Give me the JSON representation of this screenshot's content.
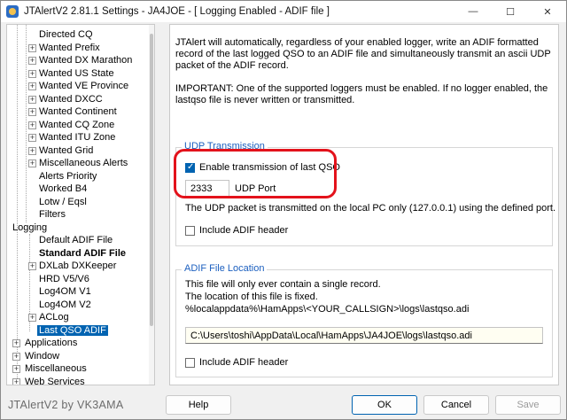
{
  "window": {
    "title": "JTAlertV2  2.81.1 Settings  -  JA4JOE  -  [ Logging Enabled - ADIF file ]",
    "minimize": "—",
    "maximize": "☐",
    "close": "✕"
  },
  "tree": {
    "items": [
      {
        "label": "Directed CQ"
      },
      {
        "label": "Wanted Prefix"
      },
      {
        "label": "Wanted DX Marathon"
      },
      {
        "label": "Wanted US State"
      },
      {
        "label": "Wanted VE Province"
      },
      {
        "label": "Wanted DXCC"
      },
      {
        "label": "Wanted Continent"
      },
      {
        "label": "Wanted CQ Zone"
      },
      {
        "label": "Wanted ITU Zone"
      },
      {
        "label": "Wanted Grid"
      },
      {
        "label": "Miscellaneous Alerts"
      },
      {
        "label": "Alerts Priority"
      },
      {
        "label": "Worked B4"
      },
      {
        "label": "Lotw / Eqsl"
      },
      {
        "label": "Filters"
      },
      {
        "label": "Logging"
      },
      {
        "label": "Default ADIF File"
      },
      {
        "label": "Standard ADIF File"
      },
      {
        "label": "DXLab DXKeeper"
      },
      {
        "label": "HRD V5/V6"
      },
      {
        "label": "Log4OM V1"
      },
      {
        "label": "Log4OM V2"
      },
      {
        "label": "ACLog"
      },
      {
        "label": "Last QSO ADIF"
      },
      {
        "label": "Applications"
      },
      {
        "label": "Window"
      },
      {
        "label": "Miscellaneous"
      },
      {
        "label": "Web Services"
      }
    ]
  },
  "panel": {
    "intro": "JTAlert will automatically, regardless of your enabled logger, write an ADIF formatted record of the last logged QSO to an ADIF file and simultaneously transmit an ascii UDP packet of the ADIF record.",
    "important": "IMPORTANT: One of the supported loggers must be enabled. If no logger enabled, the lastqso file is never written or transmitted.",
    "udp": {
      "title": "UDP Transmission",
      "enable_label": "Enable transmission of last QSO",
      "enable_checked": true,
      "port_value": "2333",
      "port_label": "UDP Port",
      "info": "The UDP packet is transmitted on the local PC only (127.0.0.1) using the defined port.",
      "header_label": "Include ADIF header",
      "header_checked": false
    },
    "adif": {
      "title": "ADIF File Location",
      "line1": "This file will only ever contain a single record.",
      "line2": "The location of this file is fixed.",
      "line3": "%localappdata%\\HamApps\\<YOUR_CALLSIGN>\\logs\\lastqso.adi",
      "path_value": "C:\\Users\\toshi\\AppData\\Local\\HamApps\\JA4JOE\\logs\\lastqso.adi",
      "header_label": "Include ADIF header",
      "header_checked": false
    }
  },
  "footer": {
    "credit": "JTAlertV2 by VK3AMA",
    "help": "Help",
    "ok": "OK",
    "cancel": "Cancel",
    "save": "Save"
  },
  "colors": {
    "accent": "#0063b1",
    "group_title": "#1b5fbf",
    "highlight_ring": "#e3121b"
  }
}
